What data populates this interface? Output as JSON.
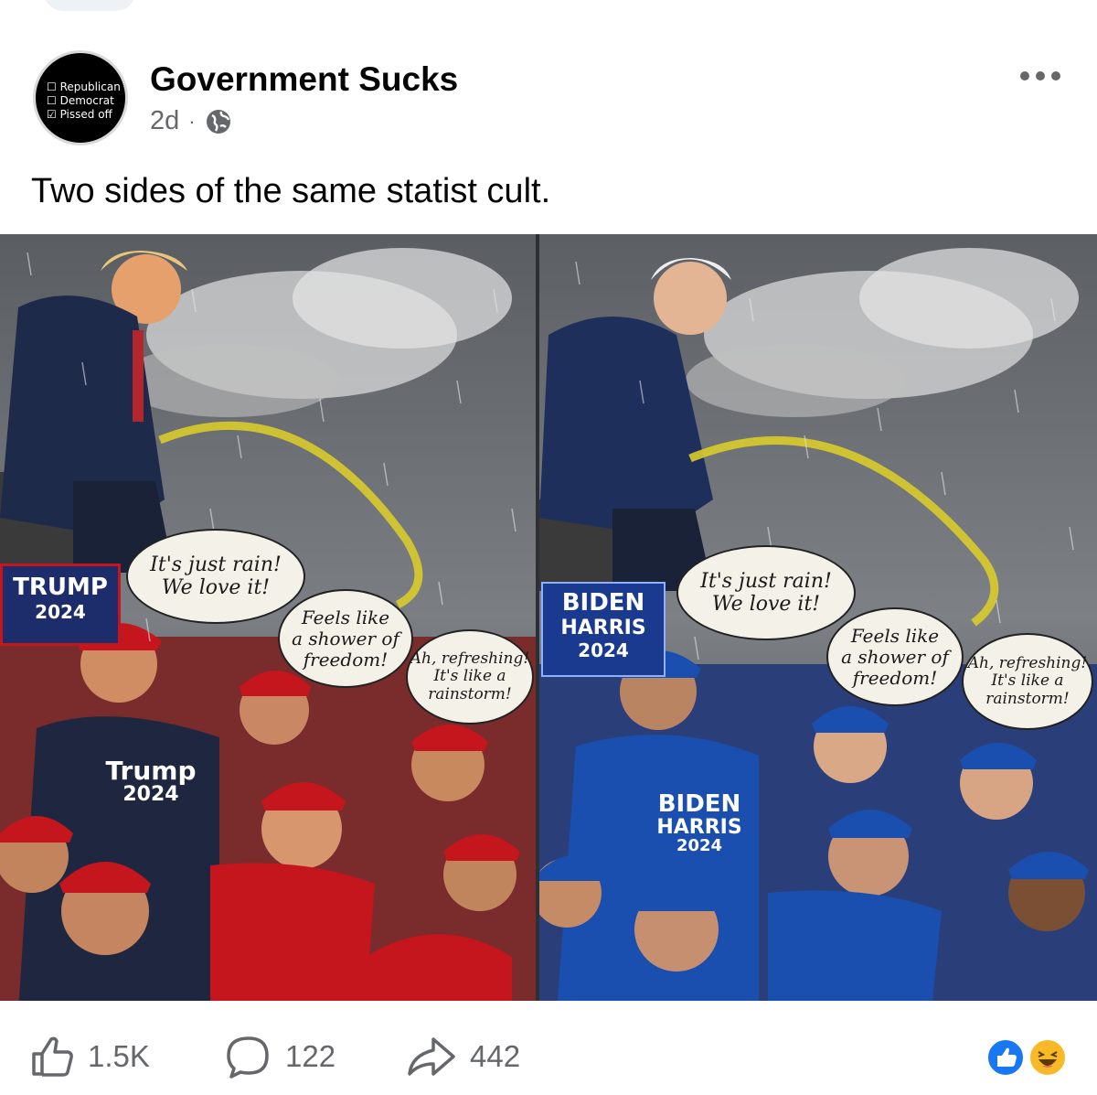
{
  "post": {
    "page_name": "Government Sucks",
    "time": "2d",
    "separator": "·",
    "privacy_icon": "globe-icon",
    "more_icon": "more-options-icon",
    "text": "Two sides of the same statist cult."
  },
  "avatar": {
    "lines": [
      "☐ Republican",
      "☐ Democrat",
      "☑ Pissed off"
    ]
  },
  "image": {
    "left_panel": {
      "sign_line1": "TRUMP",
      "sign_line2": "2024",
      "bubble1": [
        "It's just rain!",
        "We love it!"
      ],
      "bubble2": [
        "Feels like",
        "a shower of",
        "freedom!"
      ],
      "bubble3": [
        "Ah, refreshing!",
        "It's like a",
        "rainstorm!"
      ],
      "shirt_line1": "Trump",
      "shirt_line2": "2024"
    },
    "right_panel": {
      "sign_line1": "BIDEN",
      "sign_line2": "HARRIS",
      "sign_line3": "2024",
      "bubble1": [
        "It's just rain!",
        "We love it!"
      ],
      "bubble2": [
        "Feels like",
        "a shower of",
        "freedom!"
      ],
      "bubble3": [
        "Ah, refreshing!",
        "It's like a",
        "rainstorm!"
      ],
      "shirt_line1": "BIDEN",
      "shirt_line2": "HARRIS",
      "shirt_line3": "2024"
    }
  },
  "actions": {
    "like_count": "1.5K",
    "comment_count": "122",
    "share_count": "442",
    "like_icon": "thumbs-up-icon",
    "comment_icon": "comment-bubble-icon",
    "share_icon": "share-arrow-icon"
  },
  "reactions": [
    "like-reaction-icon",
    "haha-reaction-icon"
  ],
  "colors": {
    "secondary_text": "#65676b",
    "like_blue": "#1877f2",
    "haha_yellow": "#f7b928",
    "maga_red": "#c4161c",
    "biden_blue": "#1a4fb0"
  }
}
